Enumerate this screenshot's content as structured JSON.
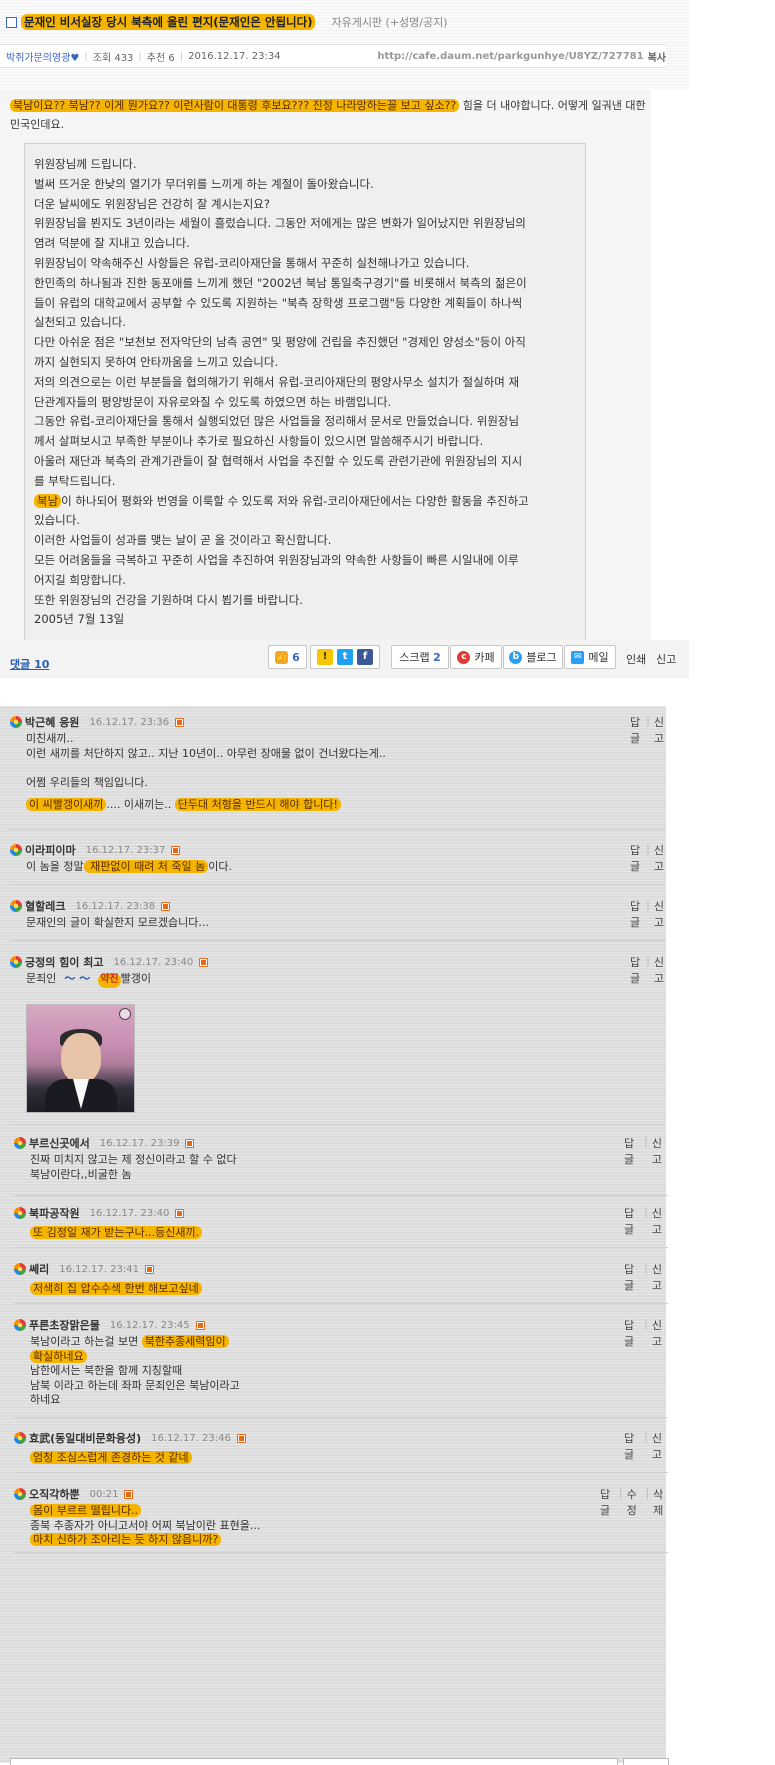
{
  "post": {
    "title": "문재인 비서실장 당시 북측에 올린 편지(문재인은 안됩니다)",
    "board": "자유게시판 (+성명/공지)",
    "author": "박쥐가문의영광♥",
    "views": "조회 433",
    "recommends": "추천 6",
    "datetime": "2016.12.17. 23:34",
    "url": "http://cafe.daum.net/parkgunhye/U8YZ/727781",
    "url_tail": "복사",
    "intro_highlight": "북남이요?? 북남?? 이게 뭔가요?? 이런사람이 대통령 후보요??? 진정 나라망하는꼴 보고 싶소??",
    "intro_rest": " 힘을 더 내야합니다. 어떻게 일궈낸 대한민국인데요.",
    "letter_lines": [
      "위원장님께 드립니다.",
      "벌써 뜨거운 한낮의 열기가 무더위를 느끼게 하는 계절이 돌아왔습니다.",
      "더운 날씨에도 위원장님은 건강히 잘 계시는지요?",
      "위원장님을 뵌지도 3년이라는 세월이 흘렀습니다. 그동안 저에게는 많은 변화가 일어났지만 위원장님의",
      "염려 덕분에 잘 지내고 있습니다.",
      "위원장님이 약속해주신 사항들은 유럽-코리아재단을 통해서 꾸준히 실천해나가고 있습니다.",
      "한민족의 하나됨과 진한 동포애를 느끼게 했던 \"2002년 북남 통일축구경기\"를 비롯해서 북측의 젊은이",
      "들이 유럽의 대학교에서 공부할 수 있도록 지원하는 \"북측 장학생 프로그램\"등 다양한 계획들이 하나씩",
      "실천되고 있습니다.",
      "다만 아쉬운 점은 \"보천보 전자악단의 남측 공연\" 및 평양에 건립을 추진했던 \"경제인 양성소\"등이 아직",
      "까지 실현되지 못하여 안타까움을 느끼고 있습니다.",
      "저의 의견으로는 이런 부분들을 협의해가기 위해서 유럽-코리아재단의 평양사무소 설치가 절실하며 재",
      "단관계자들의 평양방문이 자유로와질 수 있도록 하였으면 하는 바램입니다.",
      "그동안 유럽-코리아재단을 통해서 실행되었던 많은 사업들을 정리해서 문서로 만들었습니다. 위원장님",
      "께서 살펴보시고 부족한 부분이나 추가로 필요하신 사항들이 있으시면 말씀해주시기 바랍니다.",
      "아울러 재단과 북측의 관계기관들이 잘 협력해서 사업을 추진할 수 있도록 관련기관에 위원장님의 지시",
      "를 부탁드립니다."
    ],
    "letter_line_hl_word": "북남",
    "letter_line_hl_rest": "이 하나되어 평화와 번영을 이룩할 수 있도록 저와 유럽-코리아재단에서는 다양한 활동을 추진하고",
    "letter_tail_lines": [
      "있습니다.",
      "이러한 사업들이 성과를 맺는 날이 곧 올 것이라고 확신합니다.",
      "모든 어려움들을 극복하고 꾸준히 사업을 추진하여 위원장님과의 약속한 사항들이 빠른 시일내에 이루",
      "어지길 희망합니다.",
      "또한 위원장님의 건강을 기원하며 다시 뵙기를 바랍니다.",
      "2005년 7월 13일"
    ]
  },
  "actions": {
    "comment_link": "댓글 10",
    "like_count": "6",
    "scrap_label": "스크랩",
    "scrap_count": "2",
    "cafe": "카페",
    "blog": "블로그",
    "mail": "메일",
    "print": "인쇄",
    "report": "신고"
  },
  "comment_actions": {
    "reply": "답글",
    "report": "신고",
    "edit": "수정",
    "delete": "삭제"
  },
  "comments": [
    {
      "nick": "박근혜 응원",
      "date": "16.12.17. 23:36",
      "lines": [
        "미친새끼..",
        "이런 새끼를 처단하지 않고.. 지난 10년이.. 아무런 장애물 없이 건너왔다는게..",
        "",
        "어쩜 우리들의 책임입니다."
      ],
      "hl_a": "이 씨빨갱이새끼",
      "mid": ".... 이새끼는.. ",
      "hl_b": "단두대 처형을 반드시 해야 합니다!"
    },
    {
      "nick": "이라피이마",
      "date": "16.12.17. 23:37",
      "pre": "이 놈을 정말",
      "hl": " 재판없이 때려 처 죽일 놈",
      "post": "이다."
    },
    {
      "nick": "혈할레크",
      "date": "16.12.17. 23:38",
      "text": "문재인의 글이 확실한지 모르겠습니다..."
    },
    {
      "nick": "긍정의 힘이 최고",
      "date": "16.12.17. 23:40",
      "pre": "문죄인",
      "waves": "～ ～",
      "badge": "약진",
      "post": "빨갱이"
    },
    {
      "nick": "부르신곳에서",
      "date": "16.12.17. 23:39",
      "lines": [
        "진짜 미치지 않고는 제 정신이라고 할 수 없다",
        "북남이란다,,비굴한 놈"
      ]
    },
    {
      "nick": "북파공작원",
      "date": "16.12.17. 23:40",
      "hl": "또 김정일 재가 받는구나...등신새끼."
    },
    {
      "nick": "쎄리",
      "date": "16.12.17. 23:41",
      "hl": "저색히 집 압수수색 한번 해보고싶네"
    },
    {
      "nick": "푸른초장맑은물",
      "date": "16.12.17. 23:45",
      "pre": "북남이라고 하는걸 보면 ",
      "hl1": "북한추종세력임이",
      "hl2": "확실하네요",
      "lines": [
        "남한에서는 북한을 함께 지칭할때",
        "남북 이라고 하는데 좌파 문죄인은 북남이라고",
        "하네요"
      ]
    },
    {
      "nick": "효武(동일대비문화융성)",
      "date": "16.12.17. 23:46",
      "hl": "엄청 조심스럽게 존경하는 것 같네"
    },
    {
      "nick": "오직각하뿐",
      "date": "00:21",
      "hl1": "몸이 부르르 떨립니다..",
      "mid": "종북 추종자가 아니고서야 어찌 북남이란 표현을...",
      "hl2": "마치 신하가 조아리는 듯 하지 않읍니까?"
    }
  ],
  "colors": {
    "highlight": "#f4b400",
    "link": "#2a5db0",
    "new_badge": "#e46a1a"
  }
}
